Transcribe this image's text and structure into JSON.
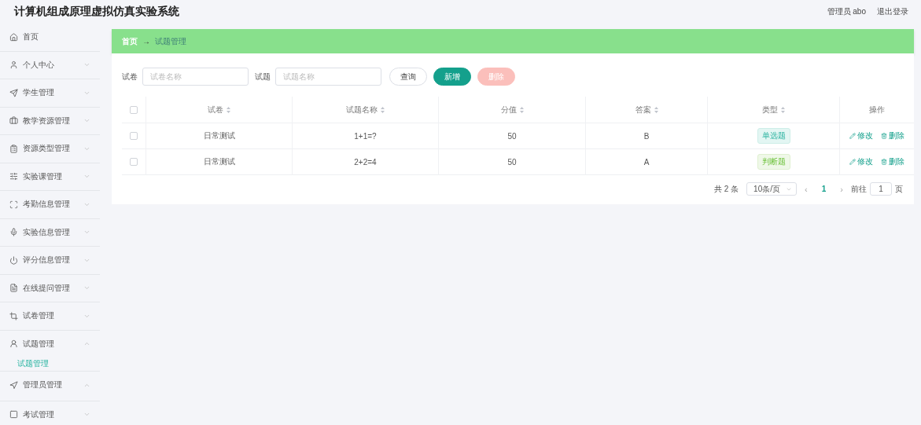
{
  "header": {
    "title": "计算机组成原理虚拟仿真实验系统",
    "user": "管理员 abo",
    "logout": "退出登录"
  },
  "sidebar": {
    "items": [
      {
        "label": "首页",
        "has_arrow": false,
        "expanded": false
      },
      {
        "label": "个人中心",
        "has_arrow": true,
        "expanded": false
      },
      {
        "label": "学生管理",
        "has_arrow": true,
        "expanded": false
      },
      {
        "label": "教学资源管理",
        "has_arrow": true,
        "expanded": false
      },
      {
        "label": "资源类型管理",
        "has_arrow": true,
        "expanded": false
      },
      {
        "label": "实验课管理",
        "has_arrow": true,
        "expanded": false
      },
      {
        "label": "考勤信息管理",
        "has_arrow": true,
        "expanded": false
      },
      {
        "label": "实验信息管理",
        "has_arrow": true,
        "expanded": false
      },
      {
        "label": "评分信息管理",
        "has_arrow": true,
        "expanded": false
      },
      {
        "label": "在线提问管理",
        "has_arrow": true,
        "expanded": false
      },
      {
        "label": "试卷管理",
        "has_arrow": true,
        "expanded": false
      },
      {
        "label": "试题管理",
        "has_arrow": true,
        "expanded": true,
        "children": [
          {
            "label": "试题管理",
            "selected": true
          }
        ]
      },
      {
        "label": "管理员管理",
        "has_arrow": true,
        "expanded": true
      },
      {
        "label": "考试管理",
        "has_arrow": true,
        "expanded": false
      }
    ]
  },
  "breadcrumb": {
    "home": "首页",
    "separator": "→",
    "current": "试题管理"
  },
  "search": {
    "fields": [
      {
        "label": "试卷",
        "placeholder": "试卷名称"
      },
      {
        "label": "试题",
        "placeholder": "试题名称"
      }
    ],
    "buttons": [
      {
        "label": "查询",
        "kind": "plain"
      },
      {
        "label": "新增",
        "kind": "primary"
      },
      {
        "label": "删除",
        "kind": "danger",
        "disabled": true
      }
    ]
  },
  "table": {
    "select_all": {
      "checked": false
    },
    "columns": [
      {
        "label": "试卷",
        "sortable": true
      },
      {
        "label": "试题名称",
        "sortable": true
      },
      {
        "label": "分值",
        "sortable": true
      },
      {
        "label": "答案",
        "sortable": true
      },
      {
        "label": "类型",
        "sortable": true
      },
      {
        "label": "操作",
        "sortable": false
      }
    ],
    "rows": [
      {
        "checked": false,
        "paper": "日常测试",
        "question": "1+1=?",
        "score": "50",
        "answer": "B",
        "type": {
          "label": "单选题",
          "kind": "single"
        },
        "actions": [
          "修改",
          "删除"
        ]
      },
      {
        "checked": false,
        "paper": "日常测试",
        "question": "2+2=4",
        "score": "50",
        "answer": "A",
        "type": {
          "label": "判断题",
          "kind": "judge"
        },
        "actions": [
          "修改",
          "删除"
        ]
      }
    ]
  },
  "pagination": {
    "total": "共 2 条",
    "page_size": "10条/页",
    "prev": "‹",
    "pages": [
      {
        "label": "1",
        "selected": true
      }
    ],
    "next": "›",
    "goto_label": "前往",
    "goto_value": "1",
    "goto_suffix": "页"
  }
}
